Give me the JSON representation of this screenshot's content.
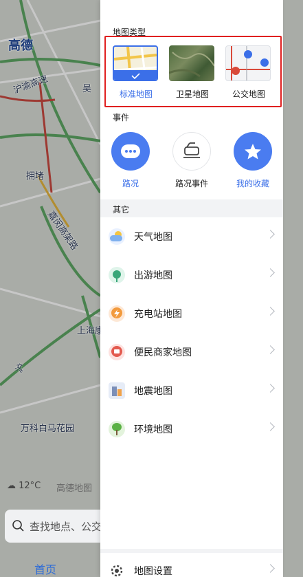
{
  "map": {
    "labels": {
      "city": "高德",
      "road1": "沪渝高速",
      "road2": "吴",
      "jam": "拥堵",
      "road3": "嘉闵高架路",
      "place1": "上海康",
      "place2": "万科白马花园",
      "road4": "沪"
    },
    "weather": "12°C",
    "brand": "高德地图",
    "search_placeholder": "查找地点、公交",
    "bottom_tab": "首页"
  },
  "panel": {
    "map_type": {
      "title": "地图类型",
      "items": [
        {
          "label": "标准地图",
          "active": true
        },
        {
          "label": "卫星地图",
          "active": false
        },
        {
          "label": "公交地图",
          "active": false
        }
      ]
    },
    "events": {
      "title": "事件",
      "items": [
        {
          "label": "路况",
          "icon": "traffic-icon"
        },
        {
          "label": "路况事件",
          "icon": "car-event-icon"
        },
        {
          "label": "我的收藏",
          "icon": "star-icon"
        }
      ]
    },
    "others": {
      "title": "其它",
      "items": [
        {
          "label": "天气地图",
          "icon": "weather-icon"
        },
        {
          "label": "出游地图",
          "icon": "travel-icon"
        },
        {
          "label": "充电站地图",
          "icon": "charging-icon"
        },
        {
          "label": "便民商家地图",
          "icon": "shop-icon"
        },
        {
          "label": "地震地图",
          "icon": "earthquake-icon"
        },
        {
          "label": "环境地图",
          "icon": "environment-icon"
        }
      ]
    },
    "settings_label": "地图设置"
  },
  "colors": {
    "accent": "#3b6fe8",
    "highlight": "#e02020"
  }
}
